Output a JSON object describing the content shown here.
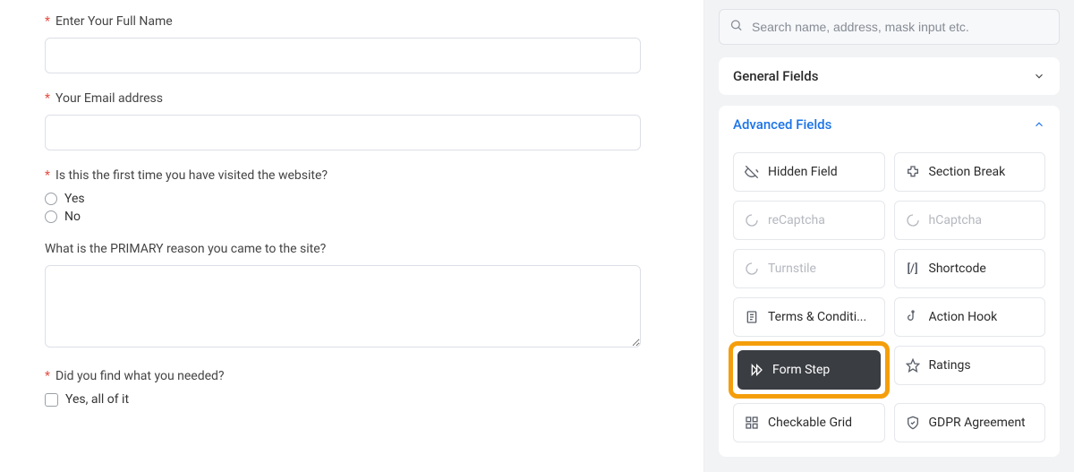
{
  "form": {
    "fields": [
      {
        "required": true,
        "label": "Enter Your Full Name",
        "type": "text"
      },
      {
        "required": true,
        "label": "Your Email address",
        "type": "text"
      },
      {
        "required": true,
        "label": "Is this the first time you have visited the website?",
        "type": "radio",
        "options": [
          "Yes",
          "No"
        ]
      },
      {
        "required": false,
        "label": "What is the PRIMARY reason you came to the site?",
        "type": "textarea"
      },
      {
        "required": true,
        "label": "Did you find what you needed?",
        "type": "checkbox",
        "options": [
          "Yes, all of it"
        ]
      }
    ]
  },
  "sidebar": {
    "search_placeholder": "Search name, address, mask input etc.",
    "sections": [
      {
        "title": "General Fields"
      },
      {
        "title": "Advanced Fields"
      }
    ],
    "advanced_fields": [
      {
        "icon": "eye-off-icon",
        "label": "Hidden Field",
        "disabled": false
      },
      {
        "icon": "puzzle-icon",
        "label": "Section Break",
        "disabled": false
      },
      {
        "icon": "spinner-icon",
        "label": "reCaptcha",
        "disabled": true
      },
      {
        "icon": "spinner-icon",
        "label": "hCaptcha",
        "disabled": true
      },
      {
        "icon": "spinner-icon",
        "label": "Turnstile",
        "disabled": true
      },
      {
        "icon": "shortcode-icon",
        "label": "Shortcode",
        "disabled": false
      },
      {
        "icon": "document-icon",
        "label": "Terms & Conditi...",
        "disabled": false
      },
      {
        "icon": "hook-icon",
        "label": "Action Hook",
        "disabled": false
      },
      {
        "icon": "skip-icon",
        "label": "Form Step",
        "disabled": false,
        "highlight": true
      },
      {
        "icon": "star-icon",
        "label": "Ratings",
        "disabled": false
      },
      {
        "icon": "grid-icon",
        "label": "Checkable Grid",
        "disabled": false
      },
      {
        "icon": "shield-icon",
        "label": "GDPR Agreement",
        "disabled": false
      }
    ]
  }
}
